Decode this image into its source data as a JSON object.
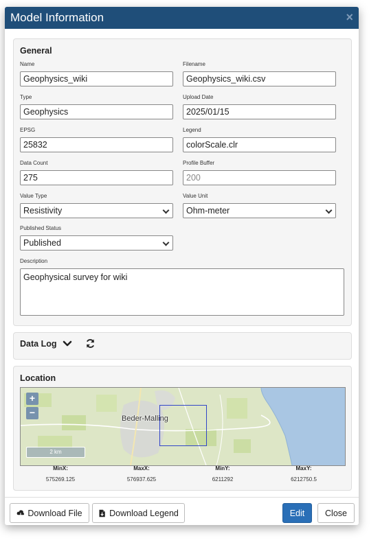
{
  "modal": {
    "title": "Model Information",
    "close_glyph": "×"
  },
  "general": {
    "title": "General",
    "name": {
      "label": "Name",
      "value": "Geophysics_wiki"
    },
    "filename": {
      "label": "Filename",
      "value": "Geophysics_wiki.csv"
    },
    "type": {
      "label": "Type",
      "value": "Geophysics"
    },
    "upload_date": {
      "label": "Upload Date",
      "value": "2025/01/15"
    },
    "epsg": {
      "label": "EPSG",
      "value": "25832"
    },
    "legend": {
      "label": "Legend",
      "value": "colorScale.clr"
    },
    "data_count": {
      "label": "Data Count",
      "value": "275"
    },
    "profile_buffer": {
      "label": "Profile Buffer",
      "placeholder": "200"
    },
    "value_type": {
      "label": "Value Type",
      "selected": "Resistivity"
    },
    "value_unit": {
      "label": "Value Unit",
      "selected": "Ohm-meter"
    },
    "published_status": {
      "label": "Published Status",
      "selected": "Published"
    },
    "description": {
      "label": "Description",
      "value": "Geophysical survey for wiki"
    }
  },
  "data_log": {
    "title": "Data Log"
  },
  "location": {
    "title": "Location",
    "map": {
      "town_label": "Beder-Malling",
      "scale_label": "2 km",
      "zoom_in": "+",
      "zoom_out": "−"
    },
    "bounds": [
      {
        "label": "MinX:",
        "value": "575269.125"
      },
      {
        "label": "MaxX:",
        "value": "576937.625"
      },
      {
        "label": "MinY:",
        "value": "6211292"
      },
      {
        "label": "MaxY:",
        "value": "6212750.5"
      }
    ]
  },
  "footer": {
    "download_file": "Download File",
    "download_legend": "Download Legend",
    "edit": "Edit",
    "close": "Close"
  },
  "colors": {
    "header": "#1f4e79",
    "primary": "#2a6fb7",
    "bbox": "#3044c8",
    "sea": "#a9c6e3"
  }
}
